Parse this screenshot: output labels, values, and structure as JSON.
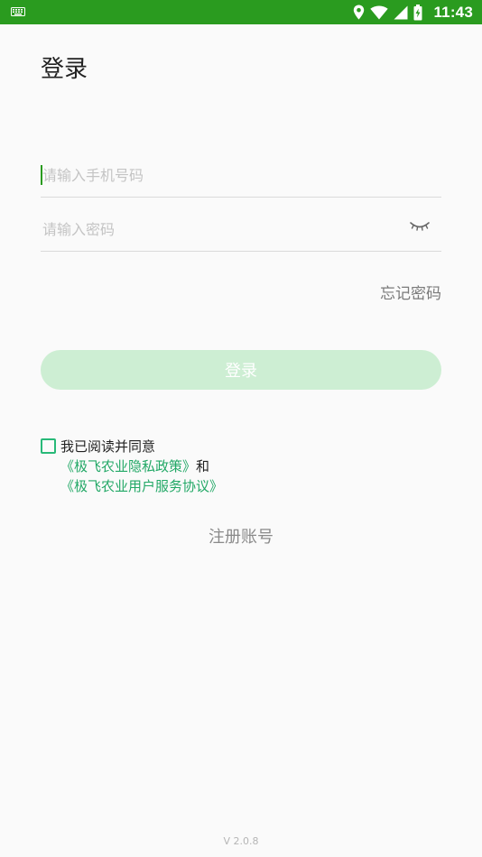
{
  "status_bar": {
    "time": "11:43",
    "icons": {
      "left": "keyboard-icon",
      "right": [
        "location-icon",
        "wifi-icon",
        "cellular-signal-icon",
        "battery-charging-icon"
      ]
    },
    "color": "#2a9b1f"
  },
  "page": {
    "title": "登录"
  },
  "form": {
    "phone_placeholder": "请输入手机号码",
    "password_placeholder": "请输入密码",
    "password_toggle_icon": "eye-closed-icon",
    "forgot_password": "忘记密码",
    "login_button": "登录"
  },
  "agreement": {
    "checkbox_checked": false,
    "intro_text": "我已阅读并同意",
    "privacy_policy": "《极飞农业隐私政策》",
    "conjunction": "和",
    "user_agreement": "《极飞农业用户服务协议》"
  },
  "register": {
    "label": "注册账号"
  },
  "footer": {
    "version": "V 2.0.8"
  },
  "colors": {
    "brand": "#2a9b1f",
    "button_disabled_bg": "#cdeed3",
    "link": "#22a866",
    "checkbox_border": "#28b978",
    "background": "#fafafa"
  }
}
